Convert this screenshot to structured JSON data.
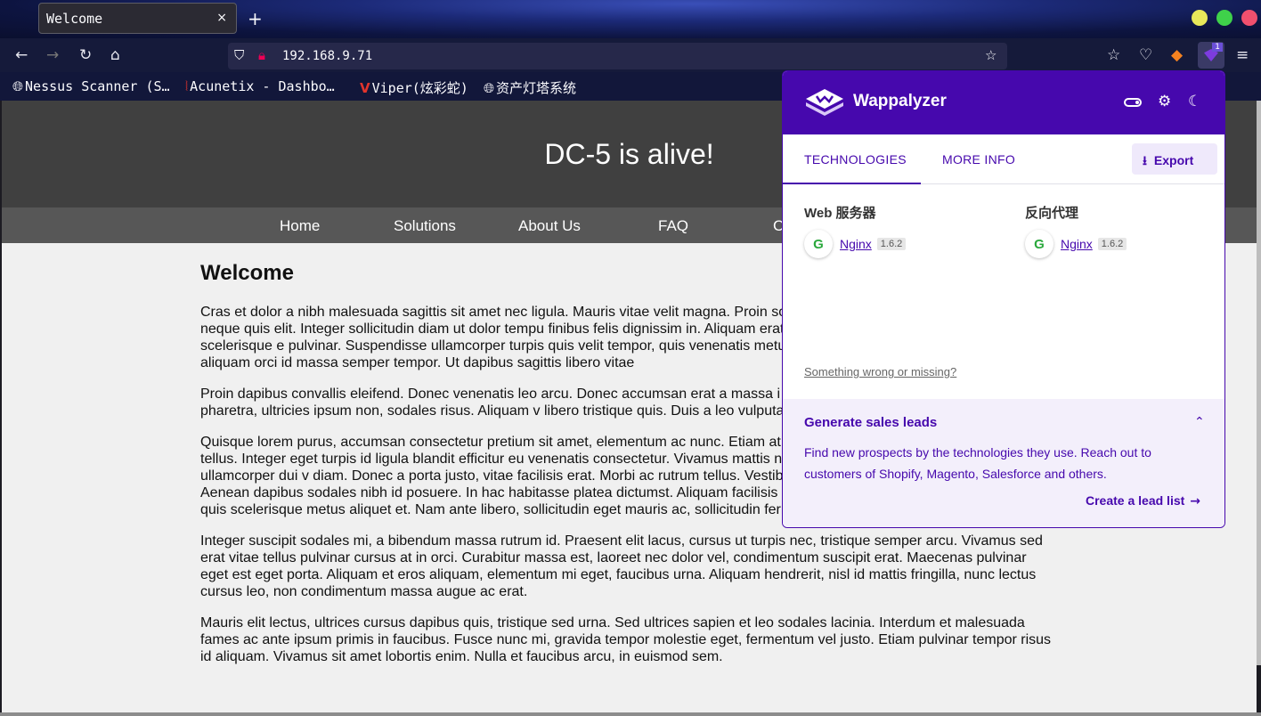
{
  "browser": {
    "tab_title": "Welcome",
    "tab_close": "×",
    "new_tab": "+",
    "url": "192.168.9.71",
    "ext_badge": "1",
    "bookmarks": [
      {
        "icon": "globe-icon",
        "label": "Nessus Scanner (S…"
      },
      {
        "icon": "acunetix-icon",
        "label": "Acunetix - Dashbo…"
      },
      {
        "icon": "viper-icon",
        "label": "Viper(炫彩蛇)"
      },
      {
        "icon": "globe-icon",
        "label": "资产灯塔系统"
      }
    ],
    "window_buttons": {
      "minimize": "#e8e85a",
      "maximize": "#3fd14a",
      "close": "#f0506e"
    }
  },
  "page": {
    "hero_title": "DC-5 is alive!",
    "menu": [
      "Home",
      "Solutions",
      "About Us",
      "FAQ",
      "C"
    ],
    "heading": "Welcome",
    "paragraphs": [
      "Cras et dolor a nibh malesuada sagittis sit amet nec ligula. Mauris vitae velit magna. Proin so urna malesuada diam, ac pulvinar orci neque quis elit. Integer sollicitudin diam ut dolor tempu finibus felis dignissim in. Aliquam erat volutpat. Quisque a diam ut eros aliquam scelerisque e pulvinar. Suspendisse ullamcorper turpis quis velit tempor, quis venenatis metus iaculis. Mau volutpat eu justo. Nulla aliquam orci id massa semper tempor. Ut dapibus sagittis libero vitae",
      "Proin dapibus convallis eleifend. Donec venenatis leo arcu. Donec accumsan erat a massa i lorem tempor egestas. Integer a quam pharetra, ultricies ipsum non, sodales risus. Aliquam v libero tristique quis. Duis a leo vulputate, sollicitudin lectus vel, pulvinar risus.",
      "Quisque lorem purus, accumsan consectetur pretium sit amet, elementum ac nunc. Etiam at c condimentum et nisi. Ut quis malesuada tellus. Integer eget turpis id ligula blandit efficitur eu venenatis consectetur. Vivamus mattis nulla non commodo lacinia. Aenean ullamcorper dui v diam. Donec a porta justo, vitae facilisis erat. Morbi ac rutrum tellus. Vestibulum cursus quam ac elit dictum vehicula. Aenean dapibus sodales nibh id posuere. In hac habitasse platea dictumst. Aliquam facilisis dignissim sodales. Nullam finibus dui nisi, quis scelerisque metus aliquet et. Nam ante libero, sollicitudin eget mauris ac, sollicitudin fermentum odio.",
      "Integer suscipit sodales mi, a bibendum massa rutrum id. Praesent elit lacus, cursus ut turpis nec, tristique semper arcu. Vivamus sed erat vitae tellus pulvinar cursus at in orci. Curabitur massa est, laoreet nec dolor vel, condimentum suscipit erat. Maecenas pulvinar eget est eget porta. Aliquam et eros aliquam, elementum mi eget, faucibus urna. Aliquam hendrerit, nisl id mattis fringilla, nunc lectus cursus leo, non condimentum massa augue ac erat.",
      "Mauris elit lectus, ultrices cursus dapibus quis, tristique sed urna. Sed ultrices sapien et leo sodales lacinia. Interdum et malesuada fames ac ante ipsum primis in faucibus. Fusce nunc mi, gravida tempor molestie eget, fermentum vel justo. Etiam pulvinar tempor risus id aliquam. Vivamus sit amet lobortis enim. Nulla et faucibus arcu, in euismod sem."
    ]
  },
  "wappalyzer": {
    "title": "Wappalyzer",
    "accent": "#4608ad",
    "tabs": {
      "technologies": "TECHNOLOGIES",
      "more_info": "MORE INFO"
    },
    "export_label": "Export",
    "categories": [
      {
        "name": "Web 服务器",
        "tech": "Nginx",
        "version": "1.6.2"
      },
      {
        "name": "反向代理",
        "tech": "Nginx",
        "version": "1.6.2"
      }
    ],
    "missing_link": "Something wrong or missing?",
    "leads": {
      "title": "Generate sales leads",
      "text": "Find new prospects by the technologies they use. Reach out to customers of Shopify, Magento, Salesforce and others.",
      "cta": "Create a lead list"
    }
  }
}
